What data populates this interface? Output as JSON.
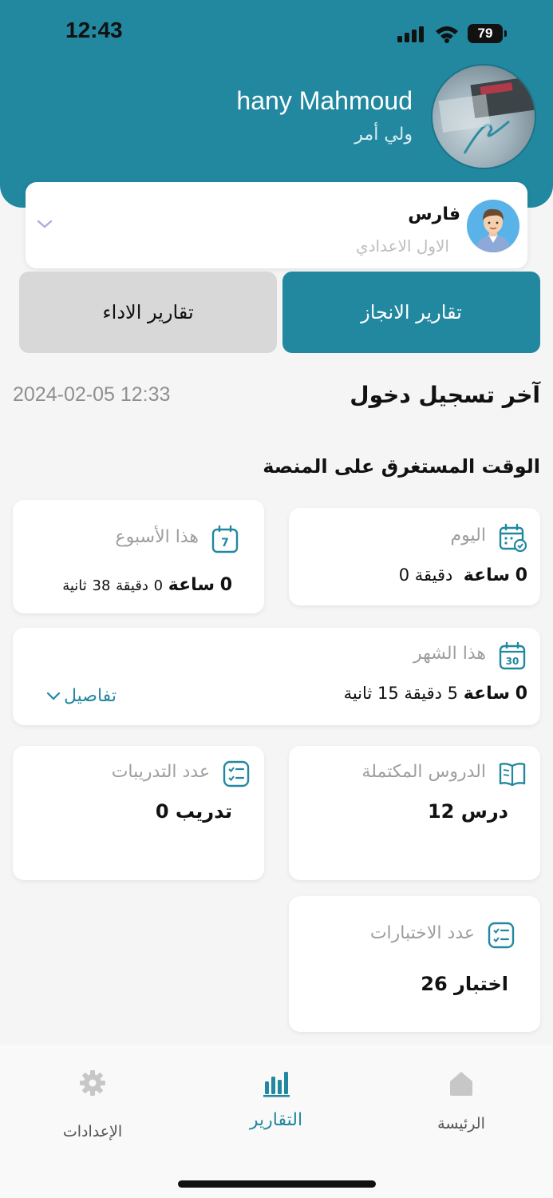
{
  "status_bar": {
    "time": "12:43",
    "battery": "79"
  },
  "header": {
    "user_name": "hany Mahmoud",
    "user_role": "ولي أمر"
  },
  "student": {
    "name": "فارس",
    "grade": "الاول الاعدادي"
  },
  "tabs": [
    {
      "label": "تقارير الانجاز",
      "active": true
    },
    {
      "label": "تقارير الاداء",
      "active": false
    }
  ],
  "last_login": {
    "title": "آخر تسجيل دخول",
    "value": "2024-02-05 12:33"
  },
  "time_on_platform": {
    "title": "الوقت المستغرق على المنصة",
    "today": {
      "label": "اليوم",
      "hours": "0",
      "hours_unit": "ساعة",
      "minutes": "0",
      "minutes_unit": "دقيقة"
    },
    "week": {
      "label": "هذا الأسبوع",
      "hours": "0",
      "hours_unit": "ساعة",
      "minutes": "0",
      "minutes_unit": "دقيقة",
      "seconds": "38",
      "seconds_unit": "ثانية"
    },
    "month": {
      "label": "هذا الشهر",
      "hours": "0",
      "hours_unit": "ساعة",
      "minutes": "5",
      "minutes_unit": "دقيقة",
      "seconds": "15",
      "seconds_unit": "ثانية",
      "details": "تفاصيل"
    }
  },
  "stats": {
    "lessons": {
      "label": "الدروس المكتملة",
      "value": "12 درس"
    },
    "trainings": {
      "label": "عدد التدريبات",
      "value": "0 تدريب"
    },
    "exams": {
      "label": "عدد الاختبارات",
      "value": "26 اختبار"
    }
  },
  "bottom_nav": [
    {
      "label": "الرئيسة",
      "icon": "home-icon",
      "active": false
    },
    {
      "label": "التقارير",
      "icon": "bar-chart-icon",
      "active": true
    },
    {
      "label": "الإعدادات",
      "icon": "gear-icon",
      "active": false
    }
  ],
  "colors": {
    "primary": "#2188a0",
    "inactive_tab": "#d8d8d8",
    "background": "#f5f5f5"
  }
}
